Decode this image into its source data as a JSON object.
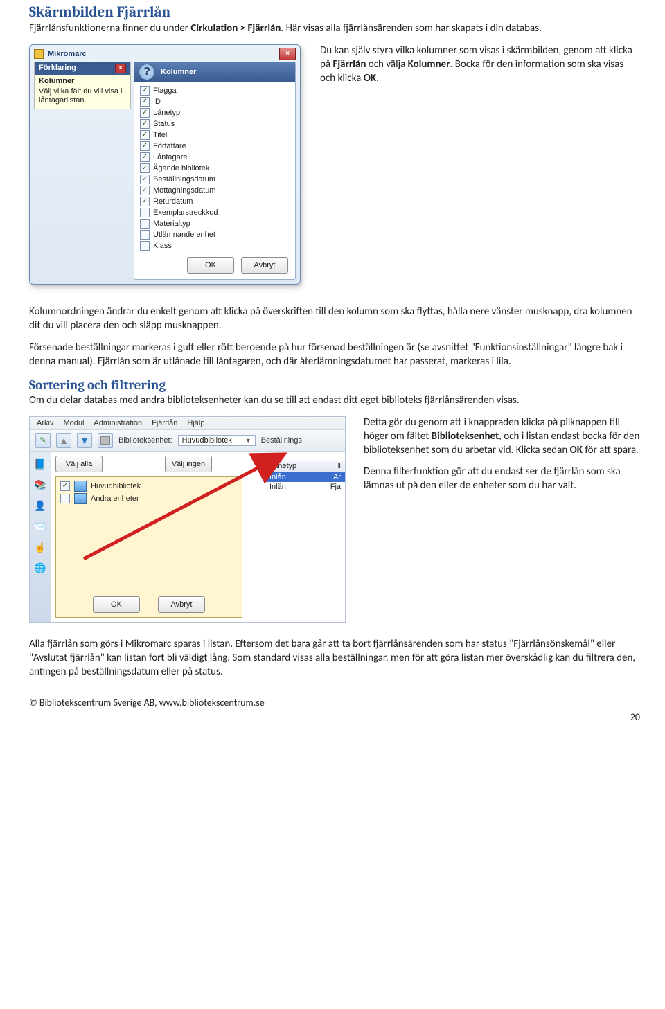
{
  "headings": {
    "h1": "Skärmbilden Fjärrlån",
    "h2": "Sortering och filtrering"
  },
  "paras": {
    "intro": "Fjärrlånsfunktionerna finner du under Cirkulation > Fjärrlån. Här visas alla fjärrlånsärenden som har skapats i din databas.",
    "right_of_shot1": "Du kan själv styra vilka kolumner som visas i skärmbilden, genom att klicka på Fjärrlån och välja Kolumner. Bocka för den information som ska visas och klicka OK.",
    "below1": "Kolumnordningen ändrar du enkelt genom att klicka på överskriften till den kolumn som ska flyttas, hålla nere vänster musknapp, dra kolumnen dit du vill placera den och släpp musknappen.",
    "below2": "Försenade beställningar markeras i gult eller rött beroende på hur försenad beställningen är (se avsnittet \"Funktionsinställningar\" längre bak i denna manual). Fjärrlån som är utlånade till låntagaren, och där återlämningsdatumet har passerat, markeras i lila.",
    "sort_intro": "Om du delar databas med andra biblioteksenheter kan du se till att endast ditt eget biblioteks fjärrlånsärenden visas.",
    "shot2_r1": "Detta gör du genom att i knappraden klicka på pilknappen till höger om fältet Biblioteksenhet, och i listan endast bocka för den biblioteksenhet som du arbetar vid. Klicka sedan OK för att spara.",
    "shot2_r2": "Denna filterfunktion gör att du endast ser de fjärrlån som ska lämnas ut på den eller de enheter som du har valt.",
    "bottom": "Alla fjärrlån som görs i Mikromarc sparas i listan. Eftersom det bara går att ta bort fjärrlånsärenden som har status \"Fjärrlånsönskemål\" eller \"Avslutat fjärrlån\" kan listan fort bli väldigt lång. Som standard visas alla beställningar, men för att göra listan mer överskådlig kan du filtrera den, antingen på beställningsdatum eller på status."
  },
  "shot1": {
    "window_title": "Mikromarc",
    "tooltip": {
      "title": "Förklaring",
      "subtitle": "Kolumner",
      "body": "Välj vilka fält du vill visa i låntagarlistan."
    },
    "panel_title": "Kolumner",
    "columns": [
      {
        "label": "Flagga",
        "checked": true
      },
      {
        "label": "ID",
        "checked": true
      },
      {
        "label": "Lånetyp",
        "checked": true
      },
      {
        "label": "Status",
        "checked": true
      },
      {
        "label": "Titel",
        "checked": true
      },
      {
        "label": "Författare",
        "checked": true
      },
      {
        "label": "Låntagare",
        "checked": true
      },
      {
        "label": "Ägande bibliotek",
        "checked": true
      },
      {
        "label": "Beställningsdatum",
        "checked": true
      },
      {
        "label": "Mottagningsdatum",
        "checked": true
      },
      {
        "label": "Returdatum",
        "checked": true
      },
      {
        "label": "Exemplarstreckkod",
        "checked": false
      },
      {
        "label": "Materialtyp",
        "checked": false
      },
      {
        "label": "Utlämnande enhet",
        "checked": false
      },
      {
        "label": "Klass",
        "checked": false
      }
    ],
    "ok": "OK",
    "cancel": "Avbryt"
  },
  "shot2": {
    "menu": [
      "Arkiv",
      "Modul",
      "Administration",
      "Fjärrlån",
      "Hjälp"
    ],
    "toolbar": {
      "label": "Biblioteksenhet:",
      "value": "Huvudbibliotek",
      "next": "Beställnings"
    },
    "buttons": {
      "all": "Välj alla",
      "none": "Välj ingen"
    },
    "units": [
      {
        "label": "Huvudbibliotek",
        "checked": true
      },
      {
        "label": "Andra enheter",
        "checked": false
      }
    ],
    "col_head": "Lånetyp",
    "rows": [
      {
        "c1": "Inlån",
        "c2": "Ar",
        "sel": true
      },
      {
        "c1": "Inlån",
        "c2": "Fja",
        "sel": false
      }
    ],
    "ok": "OK",
    "cancel": "Avbryt"
  },
  "footer": {
    "copyright": "© Bibliotekscentrum Sverige AB, www.bibliotekscentrum.se",
    "page": "20"
  }
}
